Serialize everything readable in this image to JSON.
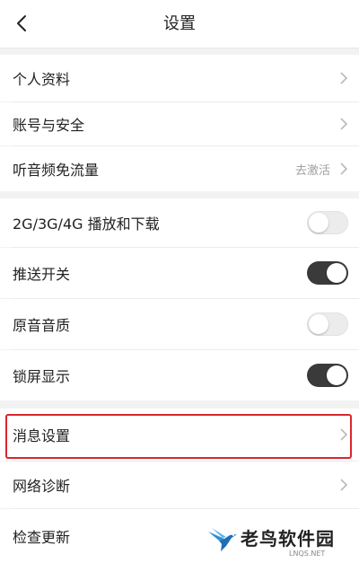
{
  "header": {
    "title": "设置",
    "back_icon": "chevron-left-icon"
  },
  "rows": [
    {
      "label": "个人资料",
      "type": "link"
    },
    {
      "label": "账号与安全",
      "type": "link"
    },
    {
      "label": "听音频免流量",
      "type": "link",
      "value": "去激活"
    },
    {
      "label": "2G/3G/4G 播放和下载",
      "type": "toggle",
      "on": false
    },
    {
      "label": "推送开关",
      "type": "toggle",
      "on": true
    },
    {
      "label": "原音音质",
      "type": "toggle",
      "on": false
    },
    {
      "label": "锁屏显示",
      "type": "toggle",
      "on": true
    },
    {
      "label": "消息设置",
      "type": "link",
      "highlighted": true
    },
    {
      "label": "网络诊断",
      "type": "link"
    },
    {
      "label": "检查更新",
      "type": "link"
    }
  ],
  "colors": {
    "highlight": "#d9262e",
    "toggle_on": "#3a3a3a",
    "toggle_off": "#ececec",
    "watermark_accent": "#2e8fd6"
  },
  "watermark": {
    "text": "老鸟软件园",
    "subtext": "LNQS.NET"
  }
}
